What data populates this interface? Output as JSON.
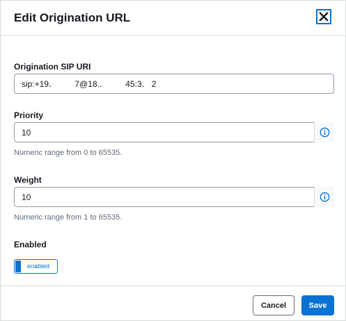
{
  "dialog": {
    "title": "Edit Origination URL",
    "close_icon": "close-icon"
  },
  "fields": {
    "sip_uri": {
      "label": "Origination SIP URI",
      "value": "sip:+19․          7@18.․          45:3․   2"
    },
    "priority": {
      "label": "Priority",
      "value": "10",
      "hint": "Numeric range from 0 to 65535.",
      "icon": "info-icon"
    },
    "weight": {
      "label": "Weight",
      "value": "10",
      "hint": "Numeric range from 1 to 65535.",
      "icon": "info-icon"
    },
    "enabled": {
      "label": "Enabled",
      "toggle_text": "enabled",
      "state": true
    }
  },
  "footer": {
    "cancel_label": "Cancel",
    "save_label": "Save"
  },
  "colors": {
    "accent": "#0972d3",
    "text": "#16191f",
    "hint": "#5f6b7a",
    "border": "#d5dbdb"
  }
}
